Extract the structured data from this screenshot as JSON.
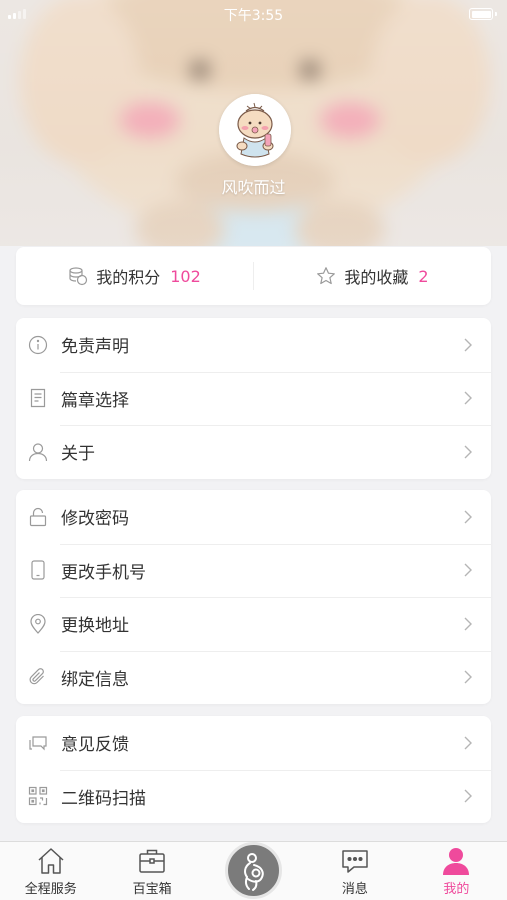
{
  "status_bar": {
    "time": "下午3:55"
  },
  "profile": {
    "username": "风吹而过"
  },
  "stats": {
    "points_label": "我的积分",
    "points_value": "102",
    "favorites_label": "我的收藏",
    "favorites_value": "2"
  },
  "menu_groups": [
    {
      "items": [
        {
          "icon": "info-icon",
          "label": "免责声明"
        },
        {
          "icon": "document-icon",
          "label": "篇章选择"
        },
        {
          "icon": "person-icon",
          "label": "关于"
        }
      ]
    },
    {
      "items": [
        {
          "icon": "lock-icon",
          "label": "修改密码"
        },
        {
          "icon": "phone-icon",
          "label": "更改手机号"
        },
        {
          "icon": "location-pin-icon",
          "label": "更换地址"
        },
        {
          "icon": "paperclip-icon",
          "label": "绑定信息"
        }
      ]
    },
    {
      "items": [
        {
          "icon": "chat-feedback-icon",
          "label": "意见反馈"
        },
        {
          "icon": "qr-code-icon",
          "label": "二维码扫描"
        }
      ]
    }
  ],
  "tabbar": {
    "items": [
      {
        "icon": "home-icon",
        "label": "全程服务"
      },
      {
        "icon": "toolbox-icon",
        "label": "百宝箱"
      },
      {
        "icon": "pregnancy-icon",
        "label": ""
      },
      {
        "icon": "message-icon",
        "label": "消息"
      },
      {
        "icon": "profile-icon",
        "label": "我的"
      }
    ],
    "active_index": 4
  },
  "colors": {
    "accent": "#ef4a9c",
    "icon_gray": "#9a9a9a",
    "background": "#f2f2f4"
  }
}
